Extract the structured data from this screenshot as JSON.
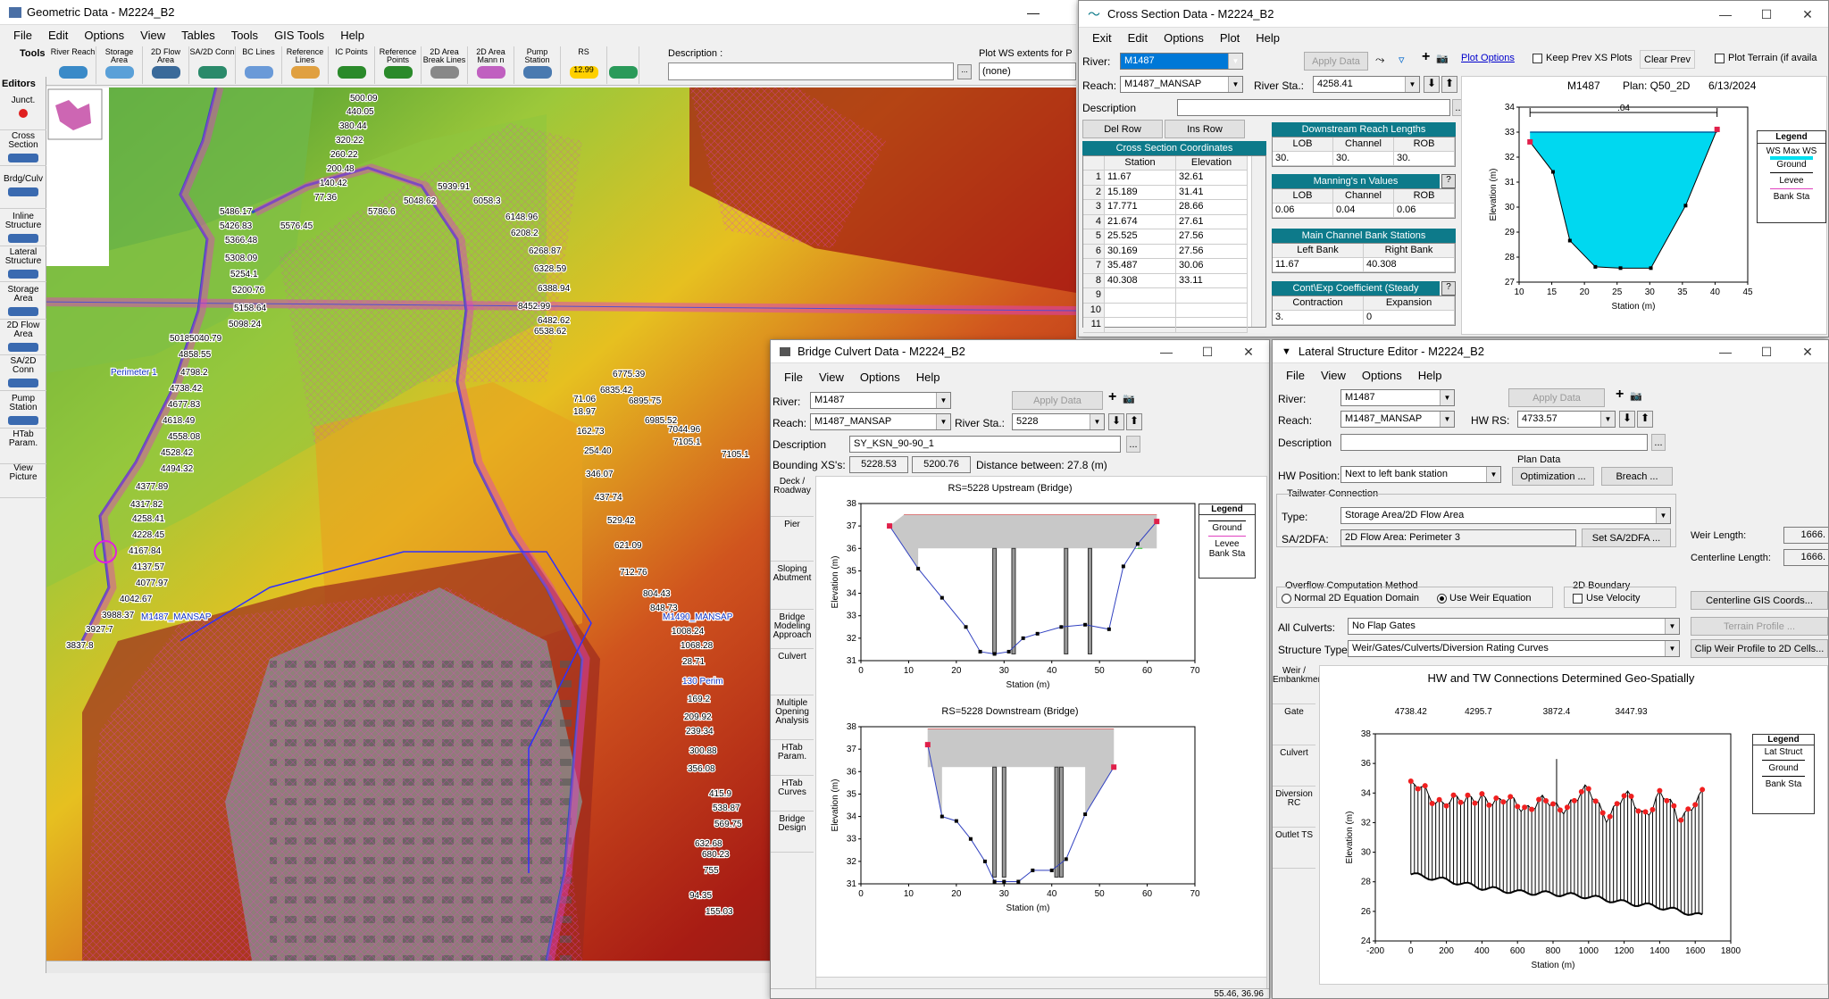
{
  "geo": {
    "title": "Geometric Data - M2224_B2",
    "menu": [
      "File",
      "Edit",
      "Options",
      "View",
      "Tables",
      "Tools",
      "GIS Tools",
      "Help"
    ],
    "tools_label": "Tools",
    "editors_label": "Editors",
    "toolbar": [
      {
        "label": "River Reach",
        "icon": "river-reach-icon"
      },
      {
        "label": "Storage Area",
        "icon": "storage-area-icon"
      },
      {
        "label": "2D Flow Area",
        "icon": "2d-flow-area-icon"
      },
      {
        "label": "SA/2D Conn",
        "icon": "sa-2d-conn-icon"
      },
      {
        "label": "BC Lines",
        "icon": "bc-lines-icon"
      },
      {
        "label": "Reference Lines",
        "icon": "reference-lines-icon"
      },
      {
        "label": "IC Points",
        "icon": "ic-points-icon"
      },
      {
        "label": "Reference Points",
        "icon": "reference-points-icon"
      },
      {
        "label": "2D Area Break Lines",
        "icon": "break-lines-icon"
      },
      {
        "label": "2D Area Mann n Regions",
        "icon": "mann-n-regions-icon"
      },
      {
        "label": "Pump Station",
        "icon": "pump-station-icon"
      },
      {
        "label": "RS",
        "icon": "rs-icon",
        "badge": "12.99"
      },
      {
        "label": "",
        "icon": "map-layer-icon"
      }
    ],
    "description_label": "Description :",
    "plot_ws_label": "Plot WS extents for P",
    "plot_ws_value": "(none)",
    "editors": [
      {
        "label": "Junct.",
        "icon": "junction-icon"
      },
      {
        "label": "Cross Section",
        "icon": "cross-section-icon"
      },
      {
        "label": "Brdg/Culv",
        "icon": "bridge-culvert-icon"
      },
      {
        "label": "Inline Structure",
        "icon": "inline-structure-icon"
      },
      {
        "label": "Lateral Structure",
        "icon": "lateral-structure-icon"
      },
      {
        "label": "Storage Area",
        "icon": "storage-area-editor-icon"
      },
      {
        "label": "2D Flow Area",
        "icon": "2d-flow-area-editor-icon"
      },
      {
        "label": "SA/2D Conn",
        "icon": "sa-2d-conn-editor-icon"
      },
      {
        "label": "Pump Station",
        "icon": "pump-station-editor-icon"
      },
      {
        "label": "HTab Param.",
        "icon": ""
      },
      {
        "label": "View Picture",
        "icon": ""
      }
    ],
    "map_labels": [
      "500.09",
      "440.05",
      "380.44",
      "320.22",
      "260.22",
      "200.48",
      "140.42",
      "5939.91",
      "77.36",
      "5048.62",
      "6058.3",
      "5486.17",
      "5786.6",
      "6148.96",
      "5426.83",
      "5576.45",
      "6208.2",
      "5366.48",
      "5308.09",
      "6268.87",
      "5254.1",
      "6328.59",
      "5200.76",
      "6388.94",
      "5158.64",
      "8452.99",
      "6482.62",
      "5098.24",
      "6538.62",
      "5018.34",
      "5040.79",
      "4858.55",
      "4798.2",
      "4738.42",
      "4677.83",
      "4618.49",
      "4558.08",
      "4528.42",
      "4494.32",
      "4377.89",
      "4317.82",
      "4258.41",
      "4228.45",
      "4167.84",
      "4137.57",
      "4077.97",
      "4042.67",
      "3988.37",
      "3927.7",
      "3837.8",
      "Perimeter 1",
      "M1487_MANSAP",
      "M1490_MANSAP",
      "6775.39",
      "6835.42",
      "6895.75",
      "6985.52",
      "7044.96",
      "7105.1",
      "7105.1",
      "71.06",
      "18.97",
      "162.73",
      "254.40",
      "346.07",
      "437.74",
      "529.42",
      "621.09",
      "712.76",
      "804.43",
      "848.73",
      "1008.24",
      "1068.28",
      "28.71",
      "130 Perim",
      "169.2",
      "209.92",
      "239.34",
      "300.88",
      "356.08",
      "415.9",
      "538.87",
      "569.75",
      "632.68",
      "680.23",
      "755",
      "94.35",
      "155.03"
    ]
  },
  "xs": {
    "title": "Cross Section Data - M2224_B2",
    "menu": [
      "Exit",
      "Edit",
      "Options",
      "Plot",
      "Help"
    ],
    "river_label": "River:",
    "river": "M1487",
    "apply": "Apply Data",
    "reach_label": "Reach:",
    "reach": "M1487_MANSAP",
    "river_sta_label": "River Sta.:",
    "river_sta": "4258.41",
    "desc_label": "Description",
    "del_row": "Del Row",
    "ins_row": "Ins Row",
    "coords_header": "Cross Section Coordinates",
    "col_station": "Station",
    "col_elev": "Elevation",
    "rows": [
      {
        "n": "1",
        "sta": "11.67",
        "el": "32.61"
      },
      {
        "n": "2",
        "sta": "15.189",
        "el": "31.41"
      },
      {
        "n": "3",
        "sta": "17.771",
        "el": "28.66"
      },
      {
        "n": "4",
        "sta": "21.674",
        "el": "27.61"
      },
      {
        "n": "5",
        "sta": "25.525",
        "el": "27.56"
      },
      {
        "n": "6",
        "sta": "30.169",
        "el": "27.56"
      },
      {
        "n": "7",
        "sta": "35.487",
        "el": "30.06"
      },
      {
        "n": "8",
        "sta": "40.308",
        "el": "33.11"
      },
      {
        "n": "9",
        "sta": "",
        "el": ""
      },
      {
        "n": "10",
        "sta": "",
        "el": ""
      },
      {
        "n": "11",
        "sta": "",
        "el": ""
      }
    ],
    "ds_reach_header": "Downstream Reach Lengths",
    "lob": "LOB",
    "channel": "Channel",
    "rob": "ROB",
    "ds_vals": [
      "30.",
      "30.",
      "30."
    ],
    "mann_header": "Manning's n Values",
    "mann_vals": [
      "0.06",
      "0.04",
      "0.06"
    ],
    "bank_header": "Main Channel Bank Stations",
    "left_bank": "Left Bank",
    "right_bank": "Right Bank",
    "bank_vals": [
      "11.67",
      "40.308"
    ],
    "cont_header": "Cont\\Exp Coefficient (Steady",
    "contraction": "Contraction",
    "expansion": "Expansion",
    "cont_vals": [
      "3.",
      "0"
    ],
    "plot_options": "Plot Options",
    "keep_prev": "Keep Prev XS Plots",
    "clear_prev": "Clear Prev",
    "plot_terrain": "Plot Terrain (if availa",
    "chart_title_1": "M1487",
    "chart_title_2": "Plan: Q50_2D",
    "chart_title_3": "6/13/2024",
    "n_label": ".04",
    "legend_title": "Legend",
    "legend": [
      "WS Max WS",
      "Ground",
      "Levee",
      "Bank Sta"
    ]
  },
  "bridge": {
    "title": "Bridge Culvert Data - M2224_B2",
    "menu": [
      "File",
      "View",
      "Options",
      "Help"
    ],
    "river_label": "River:",
    "river": "M1487",
    "apply": "Apply Data",
    "reach_label": "Reach:",
    "reach": "M1487_MANSAP",
    "river_sta_label": "River Sta.:",
    "river_sta": "5228",
    "desc_label": "Description",
    "desc": "SY_KSN_90-90_1",
    "bounding_label": "Bounding XS's:",
    "bounding": [
      "5228.53",
      "5200.76"
    ],
    "distance": "Distance between: 27.8 (m)",
    "tools": [
      "Deck / Roadway",
      "Pier",
      "Sloping Abutment",
      "Bridge Modeling Approach",
      "Culvert",
      "Multiple Opening Analysis",
      "HTab Param.",
      "HTab Curves",
      "Bridge Design"
    ],
    "up_title": "RS=5228    Upstream  (Bridge)",
    "dn_title": "RS=5228    Downstream  (Bridge)",
    "legend_title": "Legend",
    "legend": [
      "Ground",
      "Levee",
      "Bank Sta"
    ],
    "status": "55.46, 36.96"
  },
  "lat": {
    "title": "Lateral Structure Editor - M2224_B2",
    "menu": [
      "File",
      "View",
      "Options",
      "Help"
    ],
    "river_label": "River:",
    "river": "M1487",
    "apply": "Apply Data",
    "reach_label": "Reach:",
    "reach": "M1487_MANSAP",
    "hwrs_label": "HW RS:",
    "hwrs": "4733.57",
    "desc_label": "Description",
    "hwpos_label": "HW Position:",
    "hwpos": "Next to left bank station",
    "plan_data": "Plan Data",
    "optimization": "Optimization ...",
    "breach": "Breach ...",
    "tailwater": "Tailwater Connection",
    "type_label": "Type:",
    "type": "Storage Area/2D Flow Area",
    "sa2dfa_label": "SA/2DFA:",
    "sa2dfa": "2D Flow Area: Perimeter 3",
    "set_sa": "Set SA/2DFA ...",
    "weir_len_label": "Weir Length:",
    "weir_len": "1666.",
    "cl_len_label": "Centerline Length:",
    "cl_len": "1666.",
    "overflow_label": "Overflow Computation Method",
    "normal2d": "Normal 2D Equation Domain",
    "useweir": "Use Weir Equation",
    "boundary2d": "2D Boundary",
    "usevel": "Use Velocity",
    "cl_gis": "Centerline GIS Coords...",
    "all_culv_label": "All Culverts:",
    "all_culv": "No Flap Gates",
    "terrain_profile": "Terrain Profile ...",
    "struct_type_label": "Structure Type:",
    "struct_type": "Weir/Gates/Culverts/Diversion Rating Curves",
    "clip_weir": "Clip Weir Profile to 2D Cells...",
    "tools": [
      "Weir / Embankment",
      "Gate",
      "Culvert",
      "Diversion RC",
      "Outlet TS"
    ],
    "chart_title": "HW and TW Connections Determined Geo-Spatially",
    "stations": [
      "4738.42",
      "4295.7",
      "3872.4",
      "3447.93"
    ],
    "legend_title": "Legend",
    "legend": [
      "Lat Struct",
      "Ground",
      "Bank Sta"
    ]
  },
  "chart_data": [
    {
      "type": "line",
      "title": "M1487    Plan: Q50_2D    6/13/2024",
      "xlabel": "Station (m)",
      "ylabel": "Elevation (m)",
      "xlim": [
        10,
        45
      ],
      "ylim": [
        27,
        34
      ],
      "xticks": [
        10,
        15,
        20,
        25,
        30,
        35,
        40,
        45
      ],
      "yticks": [
        27,
        28,
        29,
        30,
        31,
        32,
        33,
        34
      ],
      "series": [
        {
          "name": "Ground",
          "x": [
            11.67,
            15.189,
            17.771,
            21.674,
            25.525,
            30.169,
            35.487,
            40.308
          ],
          "y": [
            32.61,
            31.41,
            28.66,
            27.61,
            27.56,
            27.56,
            30.06,
            33.11
          ]
        },
        {
          "name": "WS Max WS",
          "x": [
            11.67,
            40.308
          ],
          "y": [
            33.0,
            33.0
          ]
        }
      ],
      "bank_sta": [
        11.67,
        40.308
      ]
    },
    {
      "type": "line",
      "title": "RS=5228    Upstream  (Bridge)",
      "xlabel": "Station (m)",
      "ylabel": "Elevation (m)",
      "xlim": [
        0,
        70
      ],
      "ylim": [
        31,
        38
      ],
      "xticks": [
        0,
        10,
        20,
        30,
        40,
        50,
        60,
        70
      ],
      "yticks": [
        31,
        32,
        33,
        34,
        35,
        36,
        37,
        38
      ],
      "series": [
        {
          "name": "Ground",
          "x": [
            6,
            12,
            17,
            22,
            25,
            28,
            31,
            34,
            37,
            42,
            47,
            52,
            55,
            58,
            62
          ],
          "y": [
            37.0,
            35.1,
            33.8,
            32.5,
            31.4,
            31.3,
            31.4,
            32.0,
            32.2,
            32.5,
            32.6,
            32.4,
            35.2,
            36.2,
            37.2
          ]
        }
      ],
      "deck": {
        "low_chord": 36.0,
        "high_chord": 37.5,
        "x_start": 9,
        "x_end": 62
      },
      "piers": [
        28,
        32,
        43,
        48
      ]
    },
    {
      "type": "line",
      "title": "RS=5228    Downstream  (Bridge)",
      "xlabel": "Station (m)",
      "ylabel": "Elevation (m)",
      "xlim": [
        0,
        70
      ],
      "ylim": [
        31,
        38
      ],
      "xticks": [
        0,
        10,
        20,
        30,
        40,
        50,
        60,
        70
      ],
      "yticks": [
        31,
        32,
        33,
        34,
        35,
        36,
        37,
        38
      ],
      "series": [
        {
          "name": "Ground",
          "x": [
            14,
            17,
            20,
            23,
            26,
            28,
            30,
            33,
            36,
            40,
            43,
            47,
            53
          ],
          "y": [
            37.2,
            34.0,
            33.8,
            33.0,
            32.0,
            31.1,
            31.1,
            31.1,
            31.6,
            31.6,
            32.1,
            34.1,
            36.2
          ]
        }
      ],
      "deck": {
        "low_chord": 36.2,
        "high_chord": 37.9,
        "x_start": 14,
        "x_end": 53
      },
      "piers": [
        28,
        30,
        41,
        42
      ]
    },
    {
      "type": "line",
      "title": "HW and TW Connections Determined Geo-Spatially",
      "xlabel": "Station (m)",
      "ylabel": "Elevation (m)",
      "xlim": [
        -200,
        1800
      ],
      "ylim": [
        24,
        38
      ],
      "xticks": [
        -200,
        0,
        200,
        400,
        600,
        800,
        1000,
        1200,
        1400,
        1600,
        1800
      ],
      "yticks": [
        24,
        26,
        28,
        30,
        32,
        34,
        36,
        38
      ],
      "series": [
        {
          "name": "Lat Struct",
          "x": [
            0,
            100,
            200,
            300,
            400,
            500,
            600,
            700,
            800,
            900,
            1000,
            1100,
            1200,
            1300,
            1400,
            1500,
            1600,
            1650
          ],
          "y": [
            34.5,
            33.6,
            33.8,
            33.0,
            34.2,
            33.0,
            33.5,
            33.2,
            33.0,
            33.6,
            33.8,
            32.8,
            33.5,
            32.8,
            33.9,
            32.2,
            33.8,
            26
          ]
        },
        {
          "name": "Ground",
          "x": [
            0,
            200,
            400,
            600,
            800,
            1000,
            1200,
            1400,
            1600,
            1700
          ],
          "y": [
            28.5,
            28.1,
            27.6,
            27.3,
            27.2,
            27.0,
            26.6,
            26.3,
            25.8,
            25.5
          ]
        }
      ]
    }
  ]
}
